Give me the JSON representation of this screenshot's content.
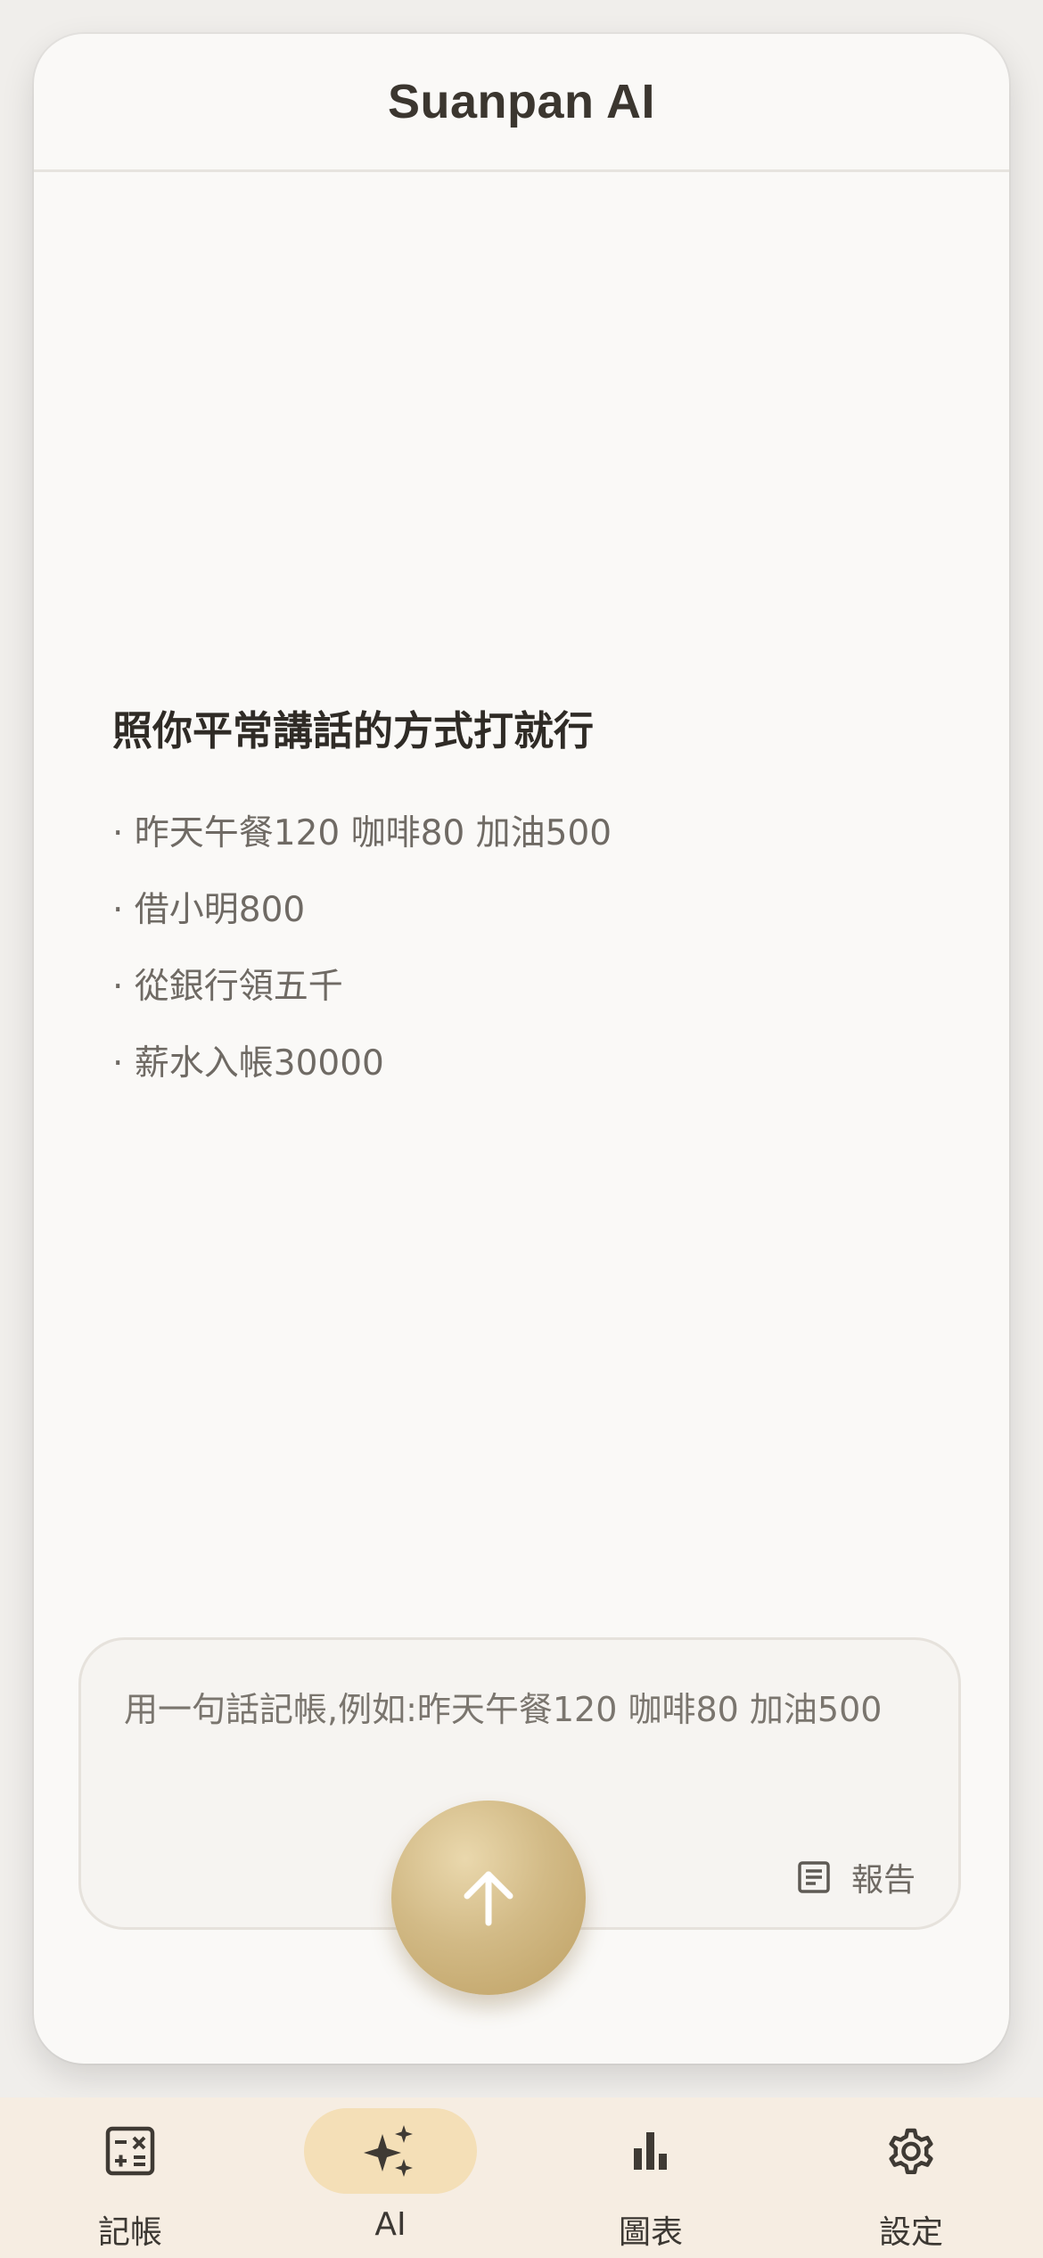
{
  "header": {
    "title": "Suanpan AI"
  },
  "guide": {
    "title": "照你平常講話的方式打就行",
    "examples": [
      "· 昨天午餐120 咖啡80 加油500",
      "· 借小明800",
      "· 從銀行領五千",
      "· 薪水入帳30000"
    ]
  },
  "composer": {
    "placeholder": "用一句話記帳,例如:昨天午餐120 咖啡80 加油500",
    "value": "",
    "report_label": "報告",
    "report_icon": "document-list-icon",
    "send_icon": "arrow-up-icon"
  },
  "nav": {
    "items": [
      {
        "label": "記帳",
        "icon": "calculator-icon",
        "active": false
      },
      {
        "label": "AI",
        "icon": "sparkle-icon",
        "active": true
      },
      {
        "label": "圖表",
        "icon": "bar-chart-icon",
        "active": false
      },
      {
        "label": "設定",
        "icon": "gear-icon",
        "active": false
      }
    ]
  },
  "colors": {
    "background": "#f0eeeb",
    "card": "#faf9f7",
    "accent": "#cdb37d",
    "nav_background": "#f6ede2",
    "nav_active": "#f4dfb7"
  }
}
